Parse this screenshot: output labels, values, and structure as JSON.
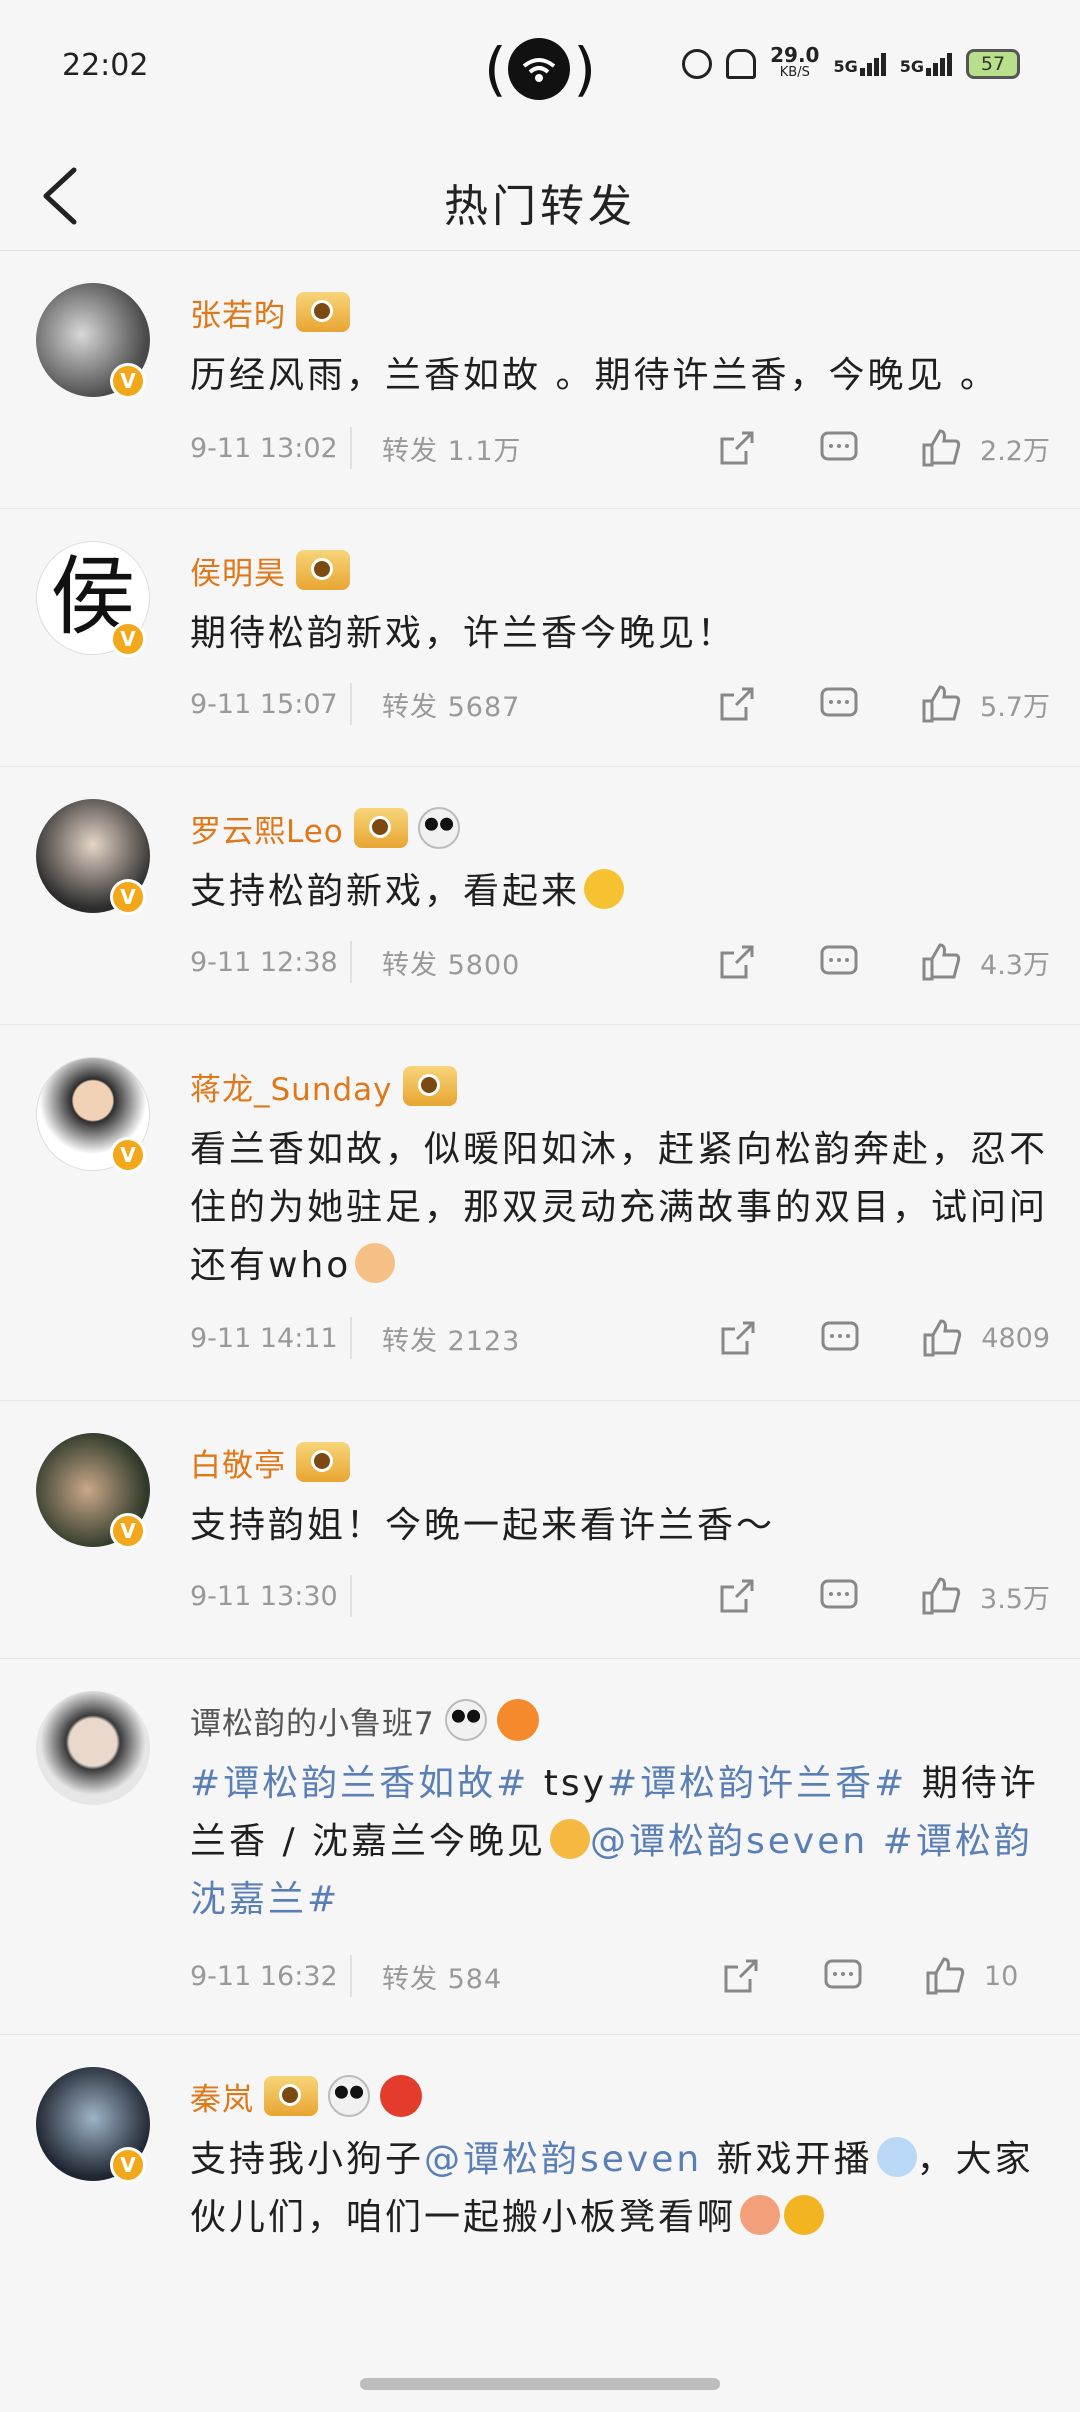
{
  "status_bar": {
    "time": "22:02",
    "net_speed": "29.0",
    "net_unit": "KB/S",
    "sig1": "5G",
    "sig2": "5G",
    "battery": "57"
  },
  "header": {
    "title": "热门转发"
  },
  "colors": {
    "name": "#e07718",
    "tag": "#5a7fb6",
    "meta": "#999999",
    "vip": "#f2a81a"
  },
  "posts": [
    {
      "name": "张若昀",
      "text": "历经风雨，兰香如故 。期待许兰香，今晚见 。",
      "time": "9-11 13:02",
      "reposts": "转发 1.1万",
      "likes": "2.2万"
    },
    {
      "name": "侯明昊",
      "avatar_char": "侯",
      "text": "期待松韵新戏，许兰香今晚见！",
      "time": "9-11 15:07",
      "reposts": "转发 5687",
      "likes": "5.7万"
    },
    {
      "name": "罗云熙Leo",
      "text": "支持松韵新戏，看起来",
      "time": "9-11 12:38",
      "reposts": "转发 5800",
      "likes": "4.3万"
    },
    {
      "name": "蒋龙_Sunday",
      "text": "看兰香如故，似暖阳如沐，赶紧向松韵奔赴，忍不住的为她驻足，那双灵动充满故事的双目，试问问还有who",
      "time": "9-11 14:11",
      "reposts": "转发 2123",
      "likes": "4809"
    },
    {
      "name": "白敬亭",
      "text": "支持韵姐！今晚一起来看许兰香～",
      "time": "9-11 13:30",
      "reposts": "",
      "likes": "3.5万"
    },
    {
      "name": "谭松韵的小鲁班7",
      "tag1": "#谭松韵兰香如故#",
      "plain1": " tsy",
      "tag2": "#谭松韵许兰香#",
      "plain2": " 期待许兰香 / 沈嘉兰今晚见",
      "mention": "@谭松韵seven",
      "tag3": " #谭松韵沈嘉兰#",
      "time": "9-11 16:32",
      "reposts": "转发 584",
      "likes": "10"
    },
    {
      "name": "秦岚",
      "plain1": "支持我小狗子",
      "mention": "@谭松韵seven",
      "plain2": " 新戏开播",
      "plain3": "，大家伙儿们，咱们一起搬小板凳看啊"
    }
  ]
}
